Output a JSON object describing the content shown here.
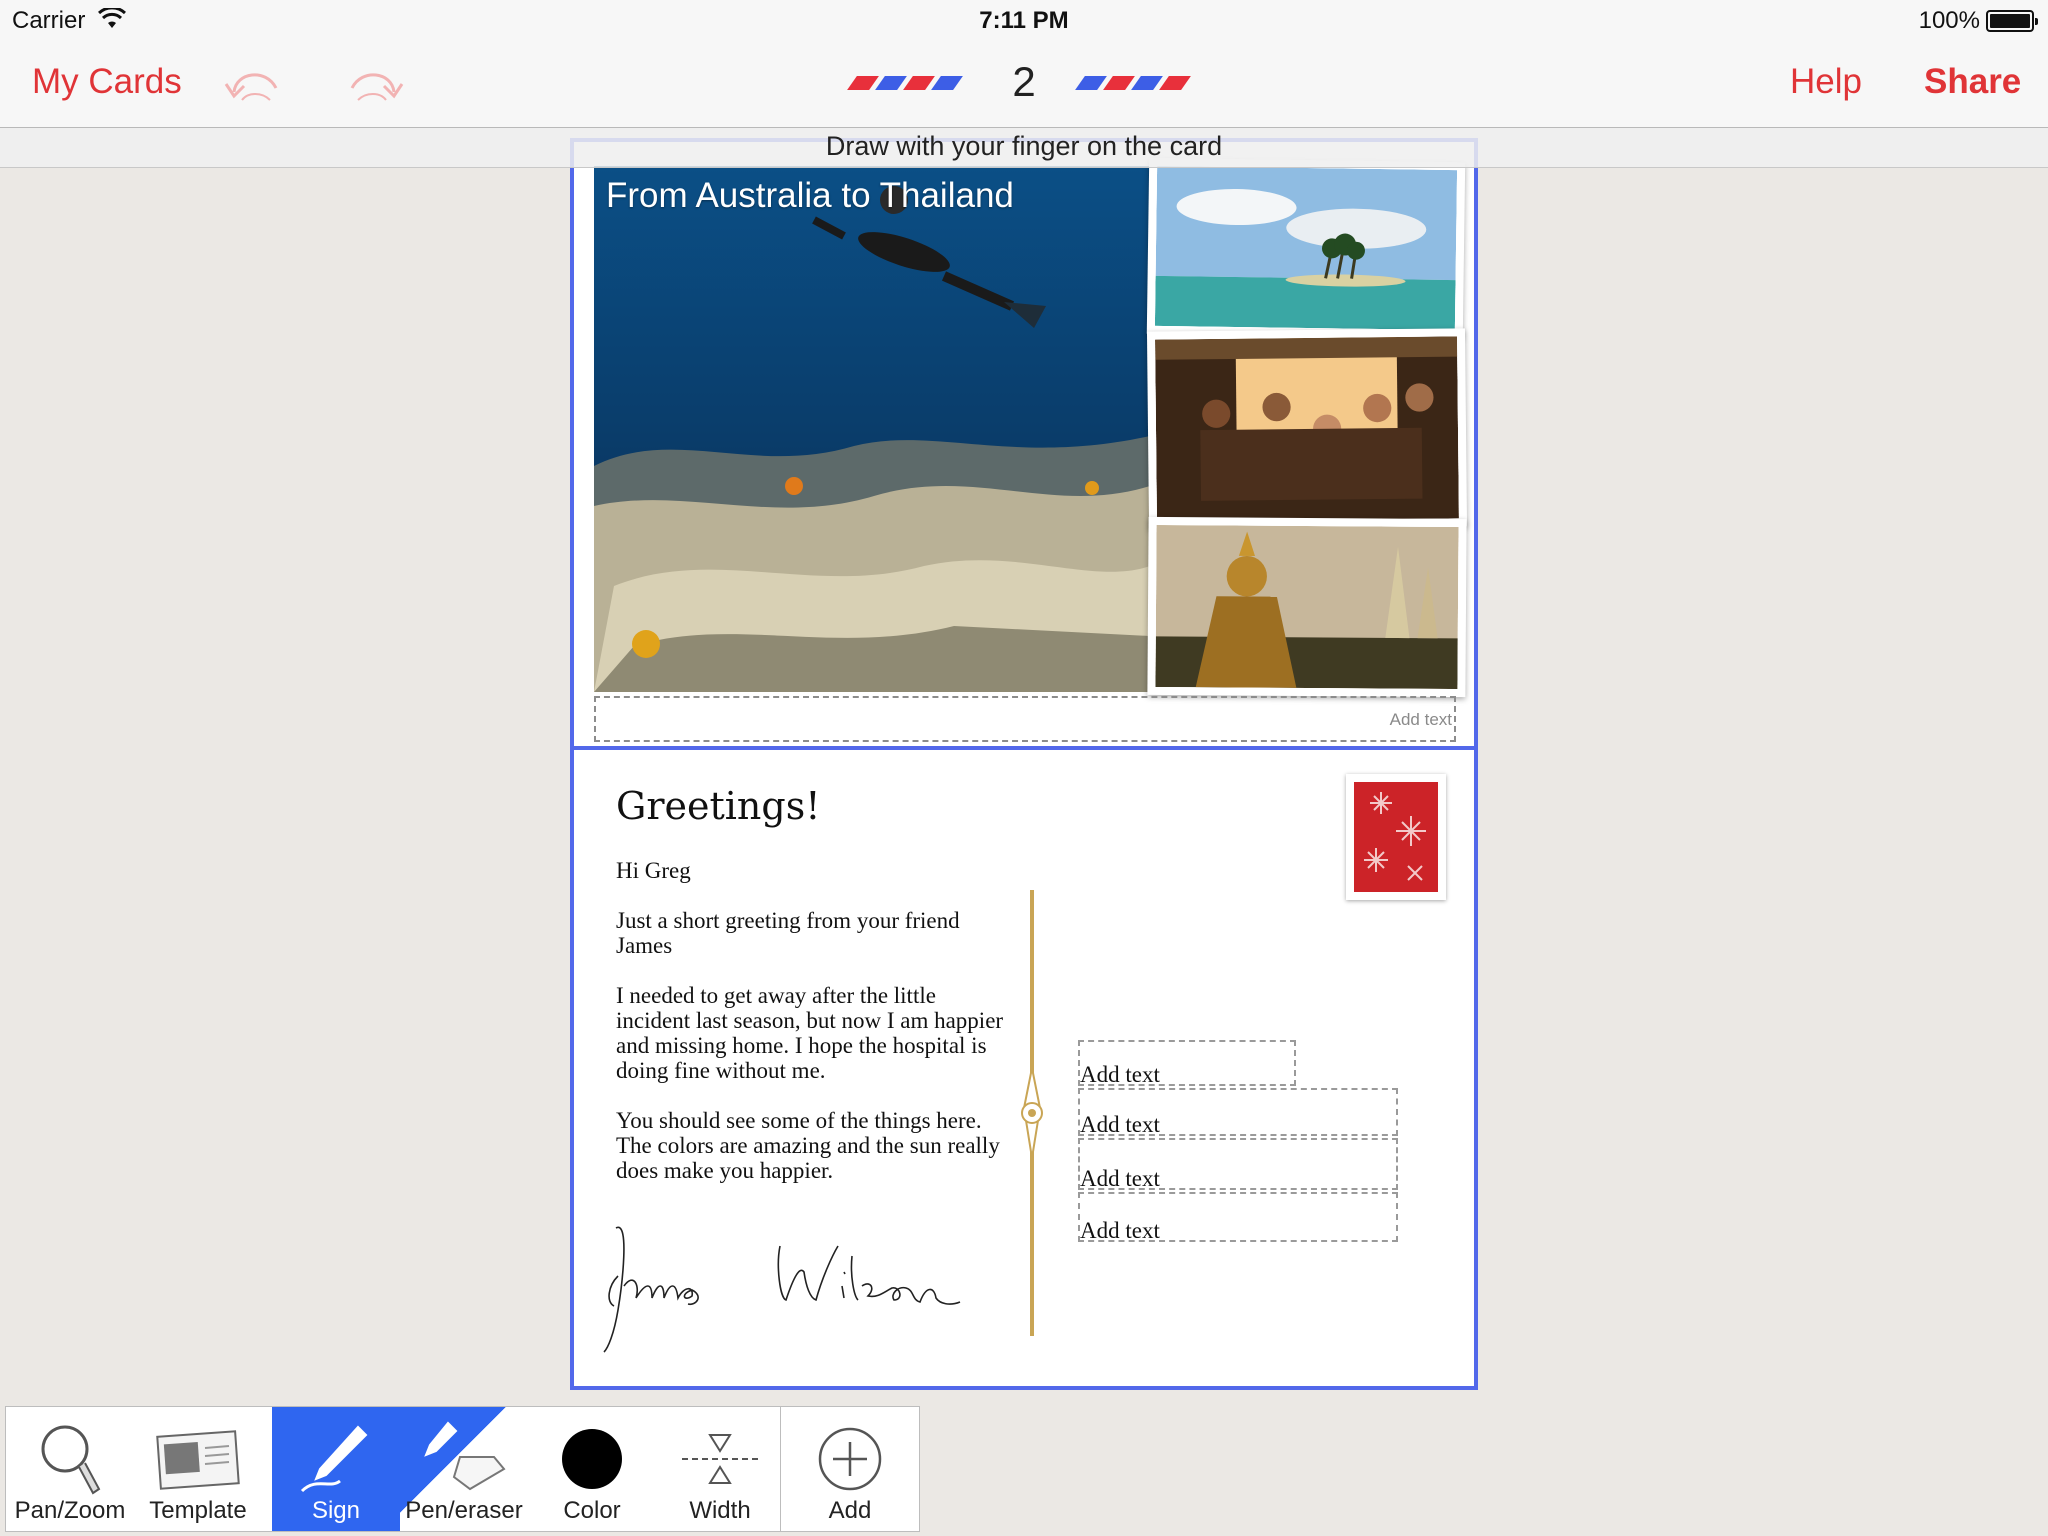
{
  "status_bar": {
    "carrier": "Carrier",
    "time": "7:11 PM",
    "battery": "100%"
  },
  "nav": {
    "back_label": "My Cards",
    "page_number": "2",
    "help_label": "Help",
    "share_label": "Share",
    "accent_color": "#e03437"
  },
  "hint": "Draw with your finger on the card",
  "card_front": {
    "title": "From Australia to Thailand",
    "add_text": "Add text"
  },
  "card_back": {
    "greeting": "Greetings!",
    "paragraphs": [
      "Hi Greg",
      "Just a short greeting from your friend James",
      "I needed to get away after the little incident last season, but now I am happier and missing home. I hope the hospital is doing fine without me.",
      "You should see some of the things here. The colors are amazing and the sun really does make you happier."
    ],
    "signature": "James Wilson",
    "address_lines": [
      "Add text",
      "Add text",
      "Add text",
      "Add text"
    ]
  },
  "toolbar": {
    "tools": [
      {
        "label": "Pan/Zoom",
        "icon": "magnifier-icon"
      },
      {
        "label": "Template",
        "icon": "template-icon"
      },
      {
        "label": "Sign",
        "icon": "pen-icon",
        "active": true
      },
      {
        "label": "Pen/eraser",
        "icon": "pen-eraser-icon"
      },
      {
        "label": "Color",
        "icon": "color-swatch-icon"
      },
      {
        "label": "Width",
        "icon": "width-icon"
      },
      {
        "label": "Add",
        "icon": "add-circle-icon"
      }
    ],
    "active_color": "#2f66f0"
  },
  "colors": {
    "card_frame": "#5268ea",
    "background": "#ebe8e4"
  }
}
